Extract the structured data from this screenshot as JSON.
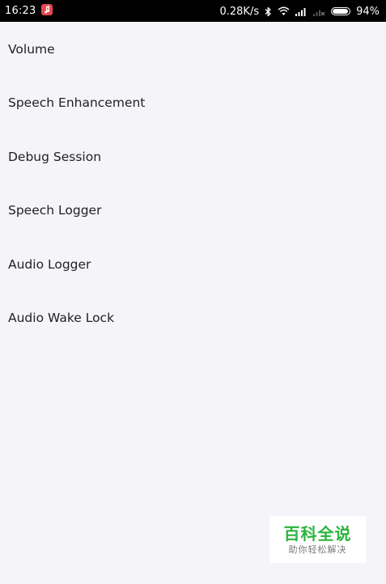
{
  "status_bar": {
    "time": "16:23",
    "network_speed": "0.28K/s",
    "battery_percent": "94%",
    "battery_level": 0.94,
    "icons": [
      "app-notification-icon",
      "bluetooth-icon",
      "wifi-icon",
      "signal-icon",
      "no-sim-signal-icon",
      "battery-icon"
    ]
  },
  "menu": {
    "items": [
      {
        "label": "Volume"
      },
      {
        "label": "Speech Enhancement"
      },
      {
        "label": "Debug Session"
      },
      {
        "label": "Speech Logger"
      },
      {
        "label": "Audio Logger"
      },
      {
        "label": "Audio Wake Lock"
      }
    ]
  },
  "watermark": {
    "title": "百科全说",
    "subtitle": "助你轻松解决"
  },
  "colors": {
    "background": "#f5f4f8",
    "status_bar": "#000000",
    "app_badge": "#e8474f",
    "watermark_green": "#2bb53f"
  }
}
